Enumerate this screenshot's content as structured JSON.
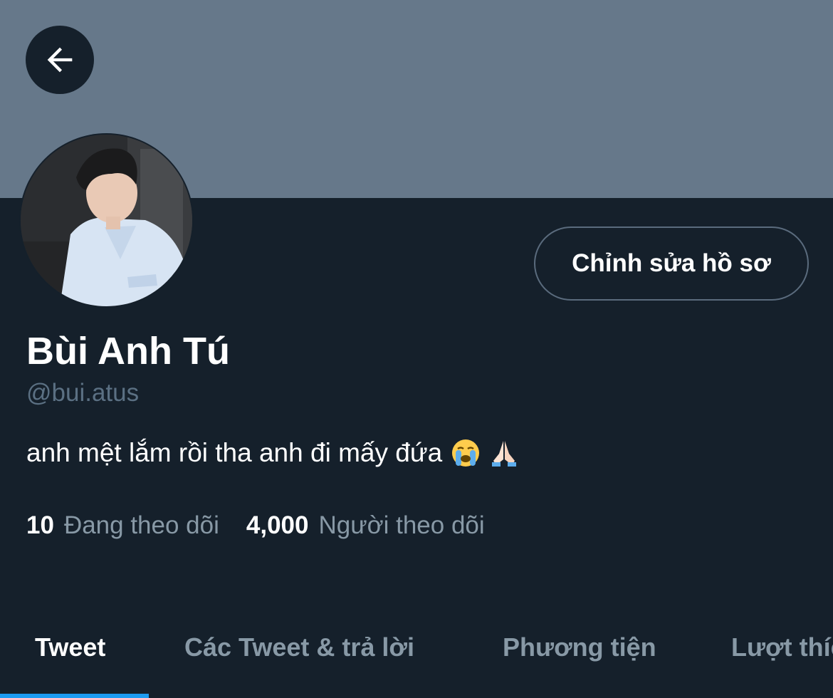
{
  "header": {
    "back_icon": "arrow-left-icon",
    "banner_color": "#66788a"
  },
  "profile": {
    "display_name": "Bùi Anh Tú",
    "handle": "@bui.atus",
    "bio": "anh mệt lắm rồi tha anh đi mấy đứa",
    "bio_emojis": [
      "loudly-crying-face-icon",
      "folded-hands-icon"
    ],
    "edit_button_label": "Chỉnh sửa hồ sơ"
  },
  "stats": {
    "following_count": "10",
    "following_label": "Đang theo dõi",
    "followers_count": "4,000",
    "followers_label": "Người theo dõi"
  },
  "tabs": [
    {
      "label": "Tweet",
      "active": true
    },
    {
      "label": "Các Tweet & trả lời",
      "active": false
    },
    {
      "label": "Phương tiện",
      "active": false
    },
    {
      "label": "Lượt thích",
      "active": false
    }
  ],
  "colors": {
    "background": "#15202b",
    "accent": "#1d9bf0",
    "secondary_text": "#8899a6"
  }
}
